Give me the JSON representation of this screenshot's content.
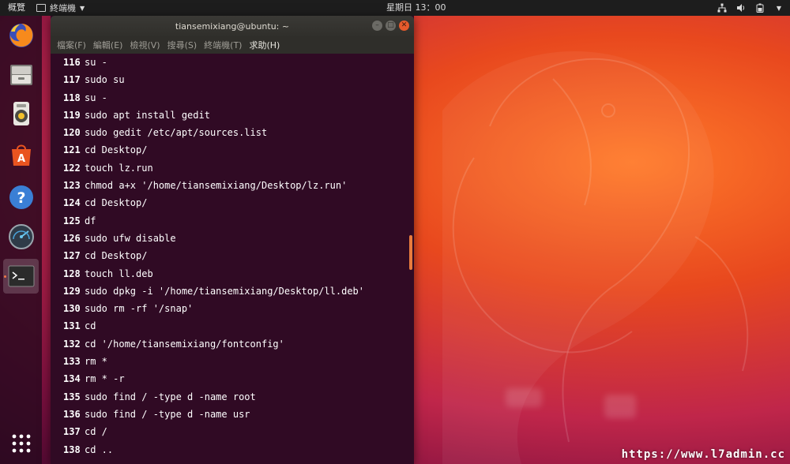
{
  "topbar": {
    "activities": "概覽",
    "app_name": "終端機",
    "clock": "星期日 13：00"
  },
  "dock": {
    "items": [
      {
        "name": "firefox"
      },
      {
        "name": "files"
      },
      {
        "name": "rhythmbox"
      },
      {
        "name": "software"
      },
      {
        "name": "help"
      },
      {
        "name": "system-monitor"
      },
      {
        "name": "terminal"
      }
    ]
  },
  "terminal": {
    "title": "tiansemixiang@ubuntu: ~",
    "menu": [
      {
        "label": "檔案(F)",
        "enabled": false
      },
      {
        "label": "編輯(E)",
        "enabled": false
      },
      {
        "label": "檢視(V)",
        "enabled": false
      },
      {
        "label": "搜尋(S)",
        "enabled": false
      },
      {
        "label": "終端機(T)",
        "enabled": false
      },
      {
        "label": "求助(H)",
        "enabled": true
      }
    ],
    "lines": [
      {
        "n": "116",
        "cmd": "su -"
      },
      {
        "n": "117",
        "cmd": "sudo su"
      },
      {
        "n": "118",
        "cmd": "su -"
      },
      {
        "n": "119",
        "cmd": "sudo apt install gedit"
      },
      {
        "n": "120",
        "cmd": "sudo gedit /etc/apt/sources.list"
      },
      {
        "n": "121",
        "cmd": "cd Desktop/"
      },
      {
        "n": "122",
        "cmd": "touch lz.run"
      },
      {
        "n": "123",
        "cmd": "chmod a+x '/home/tiansemixiang/Desktop/lz.run'"
      },
      {
        "n": "124",
        "cmd": "cd Desktop/"
      },
      {
        "n": "125",
        "cmd": "df"
      },
      {
        "n": "126",
        "cmd": "sudo ufw disable"
      },
      {
        "n": "127",
        "cmd": "cd Desktop/"
      },
      {
        "n": "128",
        "cmd": "touch ll.deb"
      },
      {
        "n": "129",
        "cmd": "sudo dpkg -i '/home/tiansemixiang/Desktop/ll.deb'"
      },
      {
        "n": "130",
        "cmd": "sudo rm -rf '/snap'"
      },
      {
        "n": "131",
        "cmd": "cd"
      },
      {
        "n": "132",
        "cmd": "cd '/home/tiansemixiang/fontconfig'"
      },
      {
        "n": "133",
        "cmd": "rm *"
      },
      {
        "n": "134",
        "cmd": "rm * -r"
      },
      {
        "n": "135",
        "cmd": "sudo find / -type d -name root"
      },
      {
        "n": "136",
        "cmd": "sudo find / -type d -name usr"
      },
      {
        "n": "137",
        "cmd": "cd /"
      },
      {
        "n": "138",
        "cmd": "cd .."
      }
    ]
  },
  "watermark": "https://www.l7admin.cc",
  "colors": {
    "terminal_bg": "#300a24",
    "accent": "#e95420",
    "scroll_thumb": "#e87c3e"
  }
}
